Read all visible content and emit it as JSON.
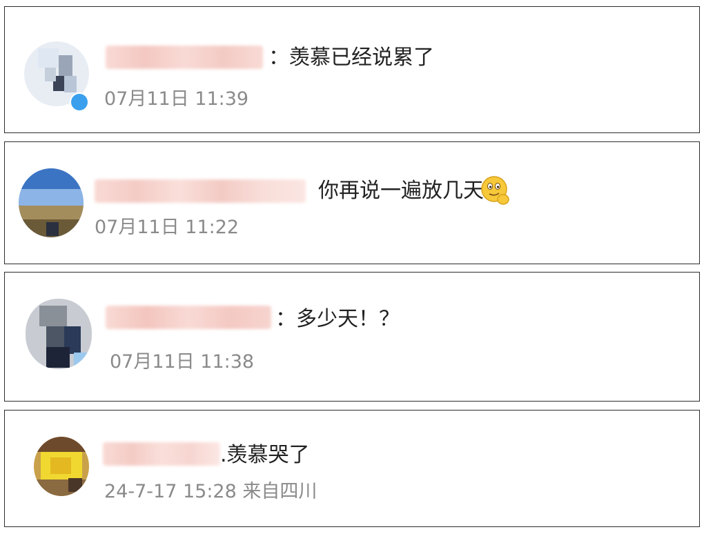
{
  "comments": [
    {
      "separator": "：",
      "text": "羡慕已经说累了",
      "time": "07月11日 11:39",
      "avatar_colors": [
        "#dfe7f2",
        "#c5cfdc",
        "#9aa6b8",
        "#6a7488",
        "#3c4458",
        "#b9c6d8"
      ]
    },
    {
      "separator": "",
      "text": "你再说一遍放几天",
      "emoji": "thinking-smile-emoji",
      "time": "07月11日 11:22",
      "avatar_colors": [
        "#3c74c4",
        "#5f94d8",
        "#8cb4e6",
        "#a48d5c",
        "#6b5a38",
        "#2a3040"
      ]
    },
    {
      "separator": "：",
      "text": "多少天！？",
      "time": "07月11日 11:38",
      "avatar_colors": [
        "#c8ccd2",
        "#8a9098",
        "#4c5664",
        "#2a3a58",
        "#1e2438",
        "#9ac8ee"
      ]
    },
    {
      "separator": "",
      "text": ".羡慕哭了",
      "time": "24-7-17 15:28 来自四川",
      "avatar_colors": [
        "#6e4a2c",
        "#c8a14a",
        "#f0d830",
        "#e4b820",
        "#8a6a40",
        "#4a3628"
      ]
    }
  ],
  "colors": {
    "name_blur": "#f6c9c2",
    "verified_badge": "#3aa0ee"
  }
}
